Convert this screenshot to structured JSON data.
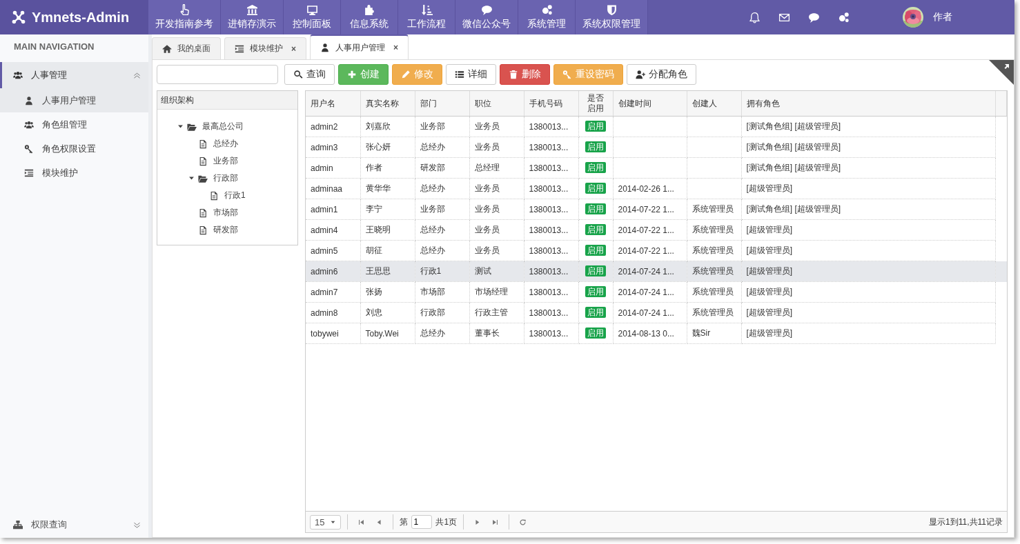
{
  "brand": {
    "name": "Ymnets-Admin"
  },
  "top_nav": [
    {
      "label": "开发指南参考"
    },
    {
      "label": "进销存演示"
    },
    {
      "label": "控制面板"
    },
    {
      "label": "信息系统"
    },
    {
      "label": "工作流程"
    },
    {
      "label": "微信公众号"
    },
    {
      "label": "系统管理"
    },
    {
      "label": "系统权限管理"
    }
  ],
  "user": {
    "name": "作者"
  },
  "sidebar": {
    "header": "MAIN NAVIGATION",
    "groups": [
      {
        "label": "人事管理",
        "expanded": true,
        "selected": true,
        "children": [
          {
            "label": "人事用户管理",
            "selected": true
          },
          {
            "label": "角色组管理",
            "selected": false
          },
          {
            "label": "角色权限设置",
            "selected": false
          },
          {
            "label": "模块维护",
            "selected": false
          }
        ]
      },
      {
        "label": "权限查询",
        "expanded": false,
        "selected": false
      }
    ]
  },
  "tabs": [
    {
      "label": "我的桌面",
      "selected": false
    },
    {
      "label": "模块维护",
      "selected": false,
      "close": "×"
    },
    {
      "label": "人事用户管理",
      "selected": true,
      "close": "×"
    }
  ],
  "toolbar": {
    "buttons": [
      {
        "label": "查询",
        "kind": "default"
      },
      {
        "label": "创建",
        "kind": "success"
      },
      {
        "label": "修改",
        "kind": "warning"
      },
      {
        "label": "详细",
        "kind": "default"
      },
      {
        "label": "删除",
        "kind": "danger"
      },
      {
        "label": "重设密码",
        "kind": "warning"
      },
      {
        "label": "分配角色",
        "kind": "default"
      }
    ]
  },
  "tree": {
    "title": "组织架构",
    "nodes": [
      {
        "label": "最高总公司",
        "kind": "folder",
        "expanded": true,
        "children": [
          {
            "label": "总经办",
            "kind": "file"
          },
          {
            "label": "业务部",
            "kind": "file"
          },
          {
            "label": "行政部",
            "kind": "folder",
            "expanded": true,
            "children": [
              {
                "label": "行政1",
                "kind": "file"
              }
            ]
          },
          {
            "label": "市场部",
            "kind": "file"
          },
          {
            "label": "研发部",
            "kind": "file"
          }
        ]
      }
    ]
  },
  "table": {
    "columns": [
      "用户名",
      "真实名称",
      "部门",
      "职位",
      "手机号码",
      "是否启用",
      "创建时间",
      "创建人",
      "拥有角色"
    ],
    "rows": [
      {
        "username": "admin2",
        "real_name": "刘嘉欣",
        "dept": "业务部",
        "position": "业务员",
        "phone": "1380013...",
        "enabled": true,
        "enabled_label": "启用",
        "roles": "[测试角色组] [超级管理员]",
        "selected": false
      },
      {
        "username": "admin3",
        "real_name": "张心妍",
        "dept": "总经办",
        "position": "业务员",
        "phone": "1380013...",
        "enabled": true,
        "enabled_label": "启用",
        "roles": "[测试角色组] [超级管理员]",
        "selected": false
      },
      {
        "username": "admin",
        "real_name": "作者",
        "dept": "研发部",
        "position": "总经理",
        "phone": "1380013...",
        "enabled": true,
        "enabled_label": "启用",
        "roles": "[测试角色组] [超级管理员]",
        "selected": false
      },
      {
        "username": "adminaa",
        "real_name": "黄华华",
        "dept": "总经办",
        "position": "业务员",
        "phone": "1380013...",
        "enabled": true,
        "enabled_label": "启用",
        "created": "2014-02-26 1...",
        "roles": "[超级管理员]",
        "selected": false
      },
      {
        "username": "admin1",
        "real_name": "李宁",
        "dept": "业务部",
        "position": "业务员",
        "phone": "1380013...",
        "enabled": true,
        "enabled_label": "启用",
        "created": "2014-07-22 1...",
        "creator": "系统管理员",
        "roles": "[测试角色组] [超级管理员]",
        "selected": false
      },
      {
        "username": "admin4",
        "real_name": "王晓明",
        "dept": "总经办",
        "position": "业务员",
        "phone": "1380013...",
        "enabled": true,
        "enabled_label": "启用",
        "created": "2014-07-22 1...",
        "creator": "系统管理员",
        "roles": "[超级管理员]",
        "selected": false
      },
      {
        "username": "admin5",
        "real_name": "胡征",
        "dept": "总经办",
        "position": "业务员",
        "phone": "1380013...",
        "enabled": true,
        "enabled_label": "启用",
        "created": "2014-07-22 1...",
        "creator": "系统管理员",
        "roles": "[超级管理员]",
        "selected": false
      },
      {
        "username": "admin6",
        "real_name": "王思思",
        "dept": "行政1",
        "position": "测试",
        "phone": "1380013...",
        "enabled": true,
        "enabled_label": "启用",
        "created": "2014-07-24 1...",
        "creator": "系统管理员",
        "roles": "[超级管理员]",
        "selected": true
      },
      {
        "username": "admin7",
        "real_name": "张扬",
        "dept": "市场部",
        "position": "市场经理",
        "phone": "1380013...",
        "enabled": true,
        "enabled_label": "启用",
        "created": "2014-07-24 1...",
        "creator": "系统管理员",
        "roles": "[超级管理员]",
        "selected": false
      },
      {
        "username": "admin8",
        "real_name": "刘忠",
        "dept": "行政部",
        "position": "行政主管",
        "phone": "1380013...",
        "enabled": true,
        "enabled_label": "启用",
        "created": "2014-07-24 1...",
        "creator": "系统管理员",
        "roles": "[超级管理员]",
        "selected": false
      },
      {
        "username": "tobywei",
        "real_name": "Toby.Wei",
        "dept": "总经办",
        "position": "董事长",
        "phone": "1380013...",
        "enabled": true,
        "enabled_label": "启用",
        "created": "2014-08-13 0...",
        "creator": "魏Sir",
        "roles": "[超级管理员]",
        "selected": false
      }
    ]
  },
  "pager": {
    "page_size": "15",
    "page_prefix": "第",
    "page": "1",
    "page_suffix": "共1页",
    "summary": "显示1到11,共11记录"
  }
}
